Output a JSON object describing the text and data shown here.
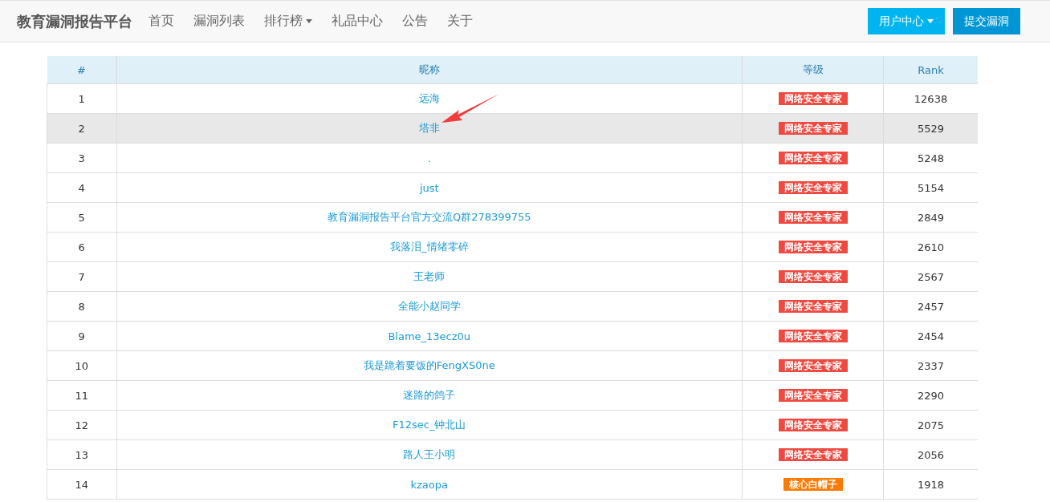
{
  "navbar": {
    "brand": "教育漏洞报告平台",
    "links": [
      {
        "label": "首页",
        "dropdown": false
      },
      {
        "label": "漏洞列表",
        "dropdown": false
      },
      {
        "label": "排行榜",
        "dropdown": true
      },
      {
        "label": "礼品中心",
        "dropdown": false
      },
      {
        "label": "公告",
        "dropdown": false
      },
      {
        "label": "关于",
        "dropdown": false
      }
    ],
    "user_button": "用户中心",
    "submit_button": "提交漏洞"
  },
  "table": {
    "columns": [
      "#",
      "昵称",
      "等级",
      "Rank"
    ],
    "rows": [
      {
        "index": "1",
        "nickname": "远海",
        "level_badge": "网络安全专家",
        "color": "#f04a40",
        "rank": "12638",
        "highlighted": false
      },
      {
        "index": "2",
        "nickname": "塔非",
        "level_badge": "网络安全专家",
        "color": "#f04a40",
        "rank": "5529",
        "highlighted": true
      },
      {
        "index": "3",
        "nickname": ".",
        "level_badge": "网络安全专家",
        "color": "#f04a40",
        "rank": "5248",
        "highlighted": false
      },
      {
        "index": "4",
        "nickname": "just",
        "level_badge": "网络安全专家",
        "color": "#f04a40",
        "rank": "5154",
        "highlighted": false
      },
      {
        "index": "5",
        "nickname": "教育漏洞报告平台官方交流Q群278399755",
        "level_badge": "网络安全专家",
        "color": "#f04a40",
        "rank": "2849",
        "highlighted": false
      },
      {
        "index": "6",
        "nickname": "我落泪_情绪零碎",
        "level_badge": "网络安全专家",
        "color": "#f04a40",
        "rank": "2610",
        "highlighted": false
      },
      {
        "index": "7",
        "nickname": "王老师",
        "level_badge": "网络安全专家",
        "color": "#f04a40",
        "rank": "2567",
        "highlighted": false
      },
      {
        "index": "8",
        "nickname": "全能小赵同学",
        "level_badge": "网络安全专家",
        "color": "#f04a40",
        "rank": "2457",
        "highlighted": false
      },
      {
        "index": "9",
        "nickname": "Blame_13ecz0u",
        "level_badge": "网络安全专家",
        "color": "#f04a40",
        "rank": "2454",
        "highlighted": false
      },
      {
        "index": "10",
        "nickname": "我是跪着要饭的FengXS0ne",
        "level_badge": "网络安全专家",
        "color": "#f04a40",
        "rank": "2337",
        "highlighted": false
      },
      {
        "index": "11",
        "nickname": "迷路的鸽子",
        "level_badge": "网络安全专家",
        "color": "#f04a40",
        "rank": "2290",
        "highlighted": false
      },
      {
        "index": "12",
        "nickname": "F12sec_钟北山",
        "level_badge": "网络安全专家",
        "color": "#f04a40",
        "rank": "2075",
        "highlighted": false
      },
      {
        "index": "13",
        "nickname": "路人王小明",
        "level_badge": "网络安全专家",
        "color": "#f04a40",
        "rank": "2056",
        "highlighted": false
      },
      {
        "index": "14",
        "nickname": "kzaopa",
        "level_badge": "核心白帽子",
        "color": "#ff7a00",
        "rank": "1918",
        "highlighted": false
      }
    ]
  },
  "annotation": {
    "kind": "arrow"
  }
}
